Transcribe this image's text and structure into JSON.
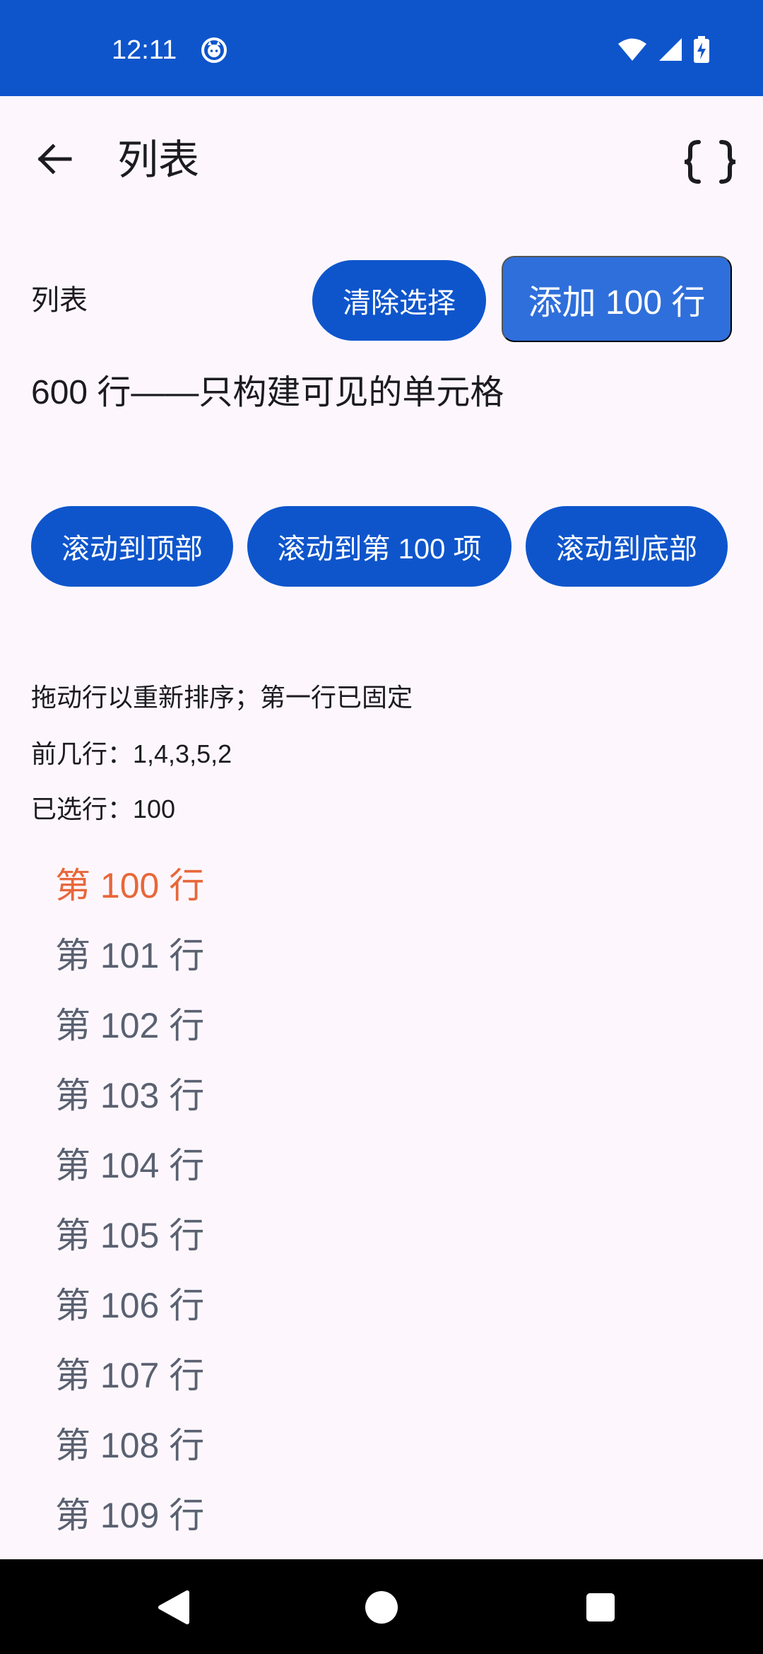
{
  "status_bar": {
    "time": "12:11",
    "icons": [
      "cat-notification-icon",
      "wifi-icon",
      "cellular-signal-icon",
      "battery-charging-icon"
    ],
    "background": "#0e55cc"
  },
  "app_bar": {
    "title": "列表",
    "back_icon": "arrow-back-icon",
    "action_icon": "code-braces-icon"
  },
  "controls": {
    "label": "列表",
    "clear_selection": "清除选择",
    "add_rows": "添加 100 行",
    "subtitle": "600 行——只构建可见的单元格",
    "scroll_top": "滚动到顶部",
    "scroll_100": "滚动到第 100 项",
    "scroll_bottom": "滚动到底部"
  },
  "info": {
    "drag_hint": "拖动行以重新排序；第一行已固定",
    "first_rows": "前几行：1,4,3,5,2",
    "selected": "已选行：100"
  },
  "rows": [
    {
      "label": "第 100 行",
      "selected": true
    },
    {
      "label": "第 101 行",
      "selected": false
    },
    {
      "label": "第 102 行",
      "selected": false
    },
    {
      "label": "第 103 行",
      "selected": false
    },
    {
      "label": "第 104 行",
      "selected": false
    },
    {
      "label": "第 105 行",
      "selected": false
    },
    {
      "label": "第 106 行",
      "selected": false
    },
    {
      "label": "第 107 行",
      "selected": false
    },
    {
      "label": "第 108 行",
      "selected": false
    },
    {
      "label": "第 109 行",
      "selected": false
    }
  ],
  "colors": {
    "primary": "#0e55cc",
    "primary_light": "#2f6fdb",
    "selected_row": "#e8673a",
    "row_text": "#5a6171",
    "background": "#fdf7fd"
  },
  "nav_bar": {
    "icons": [
      "back-triangle-icon",
      "home-circle-icon",
      "recents-square-icon"
    ]
  }
}
